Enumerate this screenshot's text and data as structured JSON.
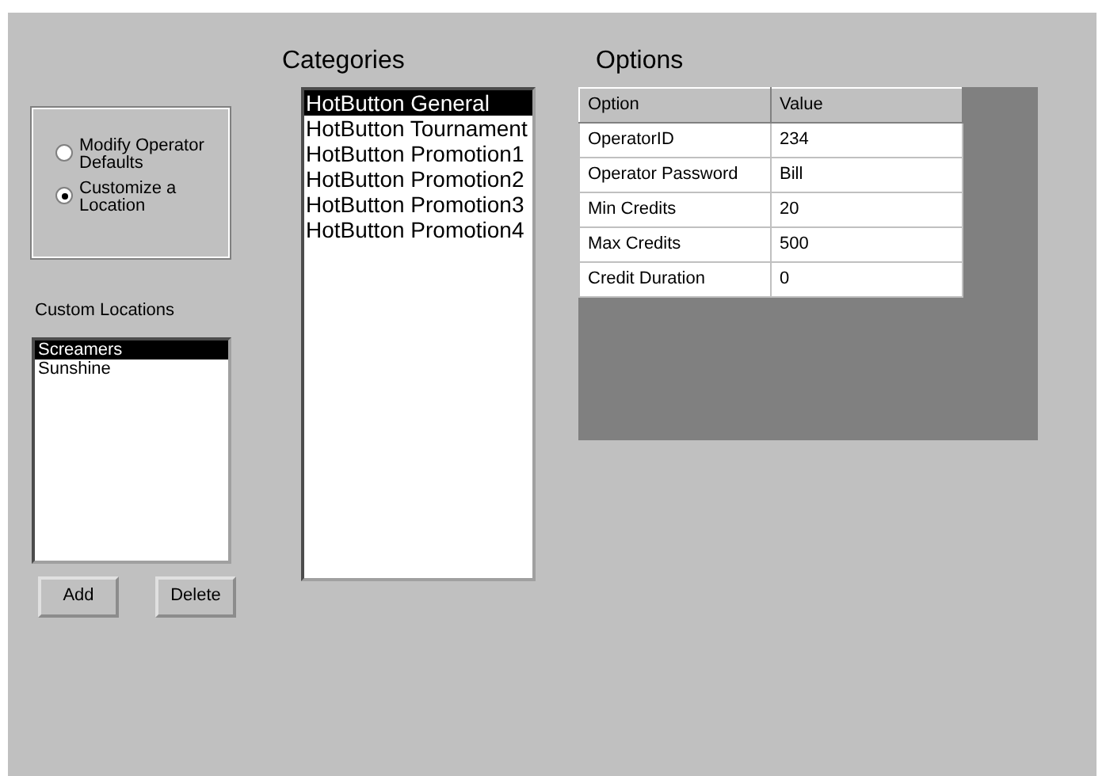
{
  "mode_options": [
    {
      "label": "Modify Operator Defaults",
      "selected": false
    },
    {
      "label": "Customize a Location",
      "selected": true
    }
  ],
  "custom_locations": {
    "label": "Custom Locations",
    "items": [
      {
        "label": "Screamers",
        "selected": true
      },
      {
        "label": "Sunshine",
        "selected": false
      }
    ]
  },
  "buttons": [
    "Add",
    "Delete"
  ],
  "categories": {
    "title": "Categories",
    "items": [
      {
        "label": "HotButton General",
        "selected": true
      },
      {
        "label": "HotButton Tournament",
        "selected": false
      },
      {
        "label": "HotButton Promotion1",
        "selected": false
      },
      {
        "label": "HotButton Promotion2",
        "selected": false
      },
      {
        "label": "HotButton Promotion3",
        "selected": false
      },
      {
        "label": "HotButton Promotion4",
        "selected": false
      }
    ]
  },
  "options": {
    "title": "Options",
    "columns": [
      "Option",
      "Value"
    ],
    "rows": [
      [
        "OperatorID",
        "234"
      ],
      [
        "Operator Password",
        "Bill"
      ],
      [
        "Min Credits",
        "20"
      ],
      [
        "Max Credits",
        "500"
      ],
      [
        "Credit Duration",
        "0"
      ]
    ]
  }
}
